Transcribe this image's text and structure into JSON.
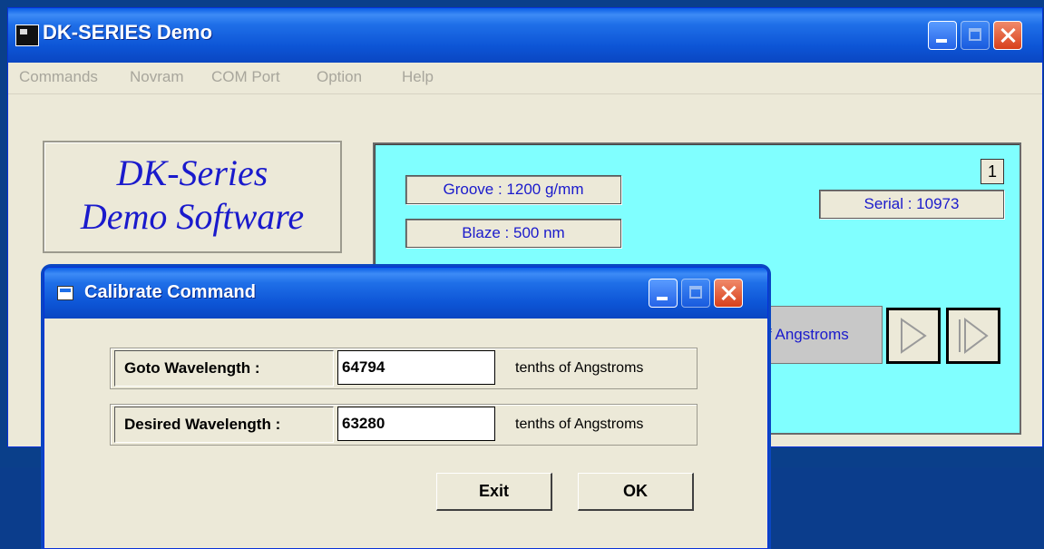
{
  "main_window": {
    "title": "DK-SERIES Demo",
    "menu": [
      "Commands",
      "Novram",
      "COM Port",
      "Option",
      "Help"
    ],
    "logo": {
      "line1": "DK-Series",
      "line2": "Demo Software"
    },
    "panel": {
      "groove": "Groove : 1200 g/mm",
      "blaze": "Blaze : 500 nm",
      "serial": "Serial : 10973",
      "number": "1",
      "partial_unit": "f Angstroms",
      "background_color": "#80ffff"
    }
  },
  "dialog": {
    "title": "Calibrate Command",
    "fields": [
      {
        "label": "Goto Wavelength :",
        "value": "64794",
        "unit": "tenths of Angstroms"
      },
      {
        "label": "Desired Wavelength :",
        "value": "63280",
        "unit": "tenths of Angstroms"
      }
    ],
    "buttons": {
      "exit": "Exit",
      "ok": "OK"
    }
  }
}
